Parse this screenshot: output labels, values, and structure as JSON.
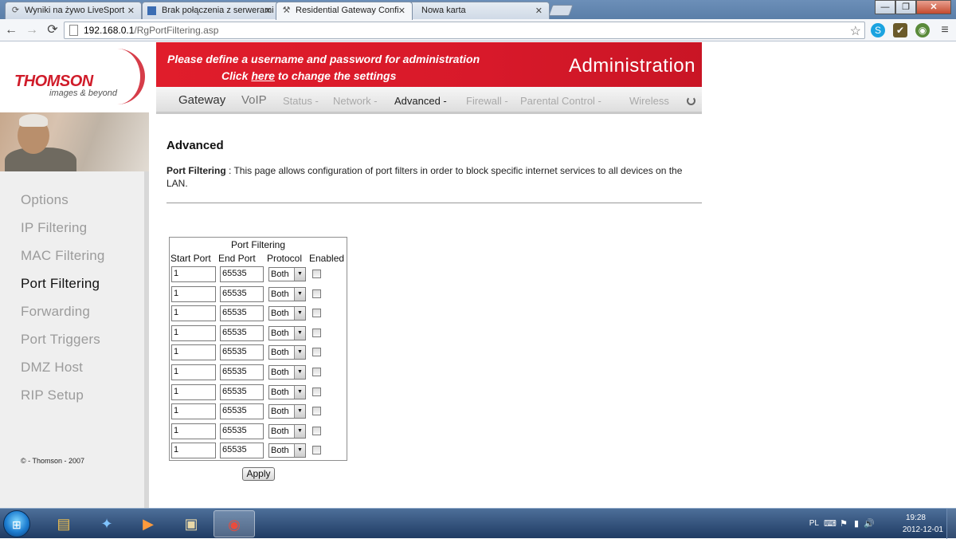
{
  "browser": {
    "tabs": [
      {
        "title": "Wyniki na żywo LiveSport",
        "icon": "refresh-favicon",
        "active": false
      },
      {
        "title": "Brak połączenia z serwerami",
        "icon": "page-favicon",
        "active": false
      },
      {
        "title": "Residential Gateway Confi",
        "icon": "tools-favicon",
        "active": true
      },
      {
        "title": "Nowa karta",
        "icon": "none",
        "active": false
      }
    ],
    "close_glyph": "✕",
    "window_buttons": {
      "minimize": "—",
      "maximize": "❐",
      "close": "✕"
    },
    "url_host": "192.168.0.1",
    "url_path": "/RgPortFiltering.asp"
  },
  "banner": {
    "line1": "Please define a username and password for administration",
    "line2_pre": "Click ",
    "line2_link": "here",
    "line2_post": " to change the settings",
    "title": "Administration"
  },
  "logo": {
    "brand": "THOMSON",
    "tagline": "images & beyond"
  },
  "topnav": {
    "gateway": "Gateway",
    "voip": "VoIP",
    "status": "Status -",
    "network": "Network -",
    "advanced": "Advanced -",
    "firewall": "Firewall -",
    "parental": "Parental Control -",
    "wireless": "Wireless"
  },
  "sidebar": {
    "items": [
      {
        "label": "Options",
        "active": false
      },
      {
        "label": "IP Filtering",
        "active": false
      },
      {
        "label": "MAC Filtering",
        "active": false
      },
      {
        "label": "Port Filtering",
        "active": true
      },
      {
        "label": "Forwarding",
        "active": false
      },
      {
        "label": "Port Triggers",
        "active": false
      },
      {
        "label": "DMZ Host",
        "active": false
      },
      {
        "label": "RIP Setup",
        "active": false
      }
    ],
    "copyright": "© - Thomson - 2007"
  },
  "main": {
    "heading": "Advanced",
    "desc_label": "Port Filtering",
    "desc_text": " :  This page allows configuration of port filters in order to block specific internet services to all devices on the LAN."
  },
  "port_filtering": {
    "caption": "Port Filtering",
    "headers": {
      "start": "Start Port",
      "end": "End Port",
      "protocol": "Protocol",
      "enabled": "Enabled"
    },
    "rows": [
      {
        "start": "1",
        "end": "65535",
        "protocol": "Both",
        "enabled": false
      },
      {
        "start": "1",
        "end": "65535",
        "protocol": "Both",
        "enabled": false
      },
      {
        "start": "1",
        "end": "65535",
        "protocol": "Both",
        "enabled": false
      },
      {
        "start": "1",
        "end": "65535",
        "protocol": "Both",
        "enabled": false
      },
      {
        "start": "1",
        "end": "65535",
        "protocol": "Both",
        "enabled": false
      },
      {
        "start": "1",
        "end": "65535",
        "protocol": "Both",
        "enabled": false
      },
      {
        "start": "1",
        "end": "65535",
        "protocol": "Both",
        "enabled": false
      },
      {
        "start": "1",
        "end": "65535",
        "protocol": "Both",
        "enabled": false
      },
      {
        "start": "1",
        "end": "65535",
        "protocol": "Both",
        "enabled": false
      },
      {
        "start": "1",
        "end": "65535",
        "protocol": "Both",
        "enabled": false
      }
    ],
    "apply_label": "Apply"
  },
  "taskbar": {
    "apps": [
      "explorer-icon",
      "network-icon",
      "media-player-icon",
      "archive-icon",
      "chrome-icon"
    ],
    "language": "PL",
    "time": "19:28",
    "date": "2012-12-01"
  },
  "colors": {
    "brand_red": "#d01c2a",
    "banner_red": "#e01d2b",
    "sidebar_bg": "#efefef"
  }
}
